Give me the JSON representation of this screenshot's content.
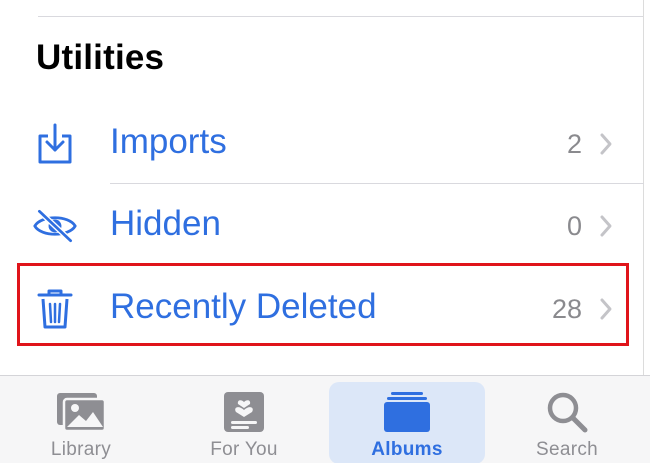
{
  "section": {
    "title": "Utilities"
  },
  "rows": [
    {
      "label": "Imports",
      "count": "2",
      "icon": "import-icon"
    },
    {
      "label": "Hidden",
      "count": "0",
      "icon": "eye-slash-icon"
    },
    {
      "label": "Recently Deleted",
      "count": "28",
      "icon": "trash-icon"
    }
  ],
  "tabs": [
    {
      "label": "Library",
      "icon": "photo-library-icon",
      "active": false
    },
    {
      "label": "For You",
      "icon": "for-you-icon",
      "active": false
    },
    {
      "label": "Albums",
      "icon": "albums-icon",
      "active": true
    },
    {
      "label": "Search",
      "icon": "search-icon",
      "active": false
    }
  ],
  "colors": {
    "accent": "#2f6fe0",
    "secondary_text": "#8a8a8e",
    "highlight": "#e0141a",
    "tab_inactive": "#8e8e93",
    "tab_active_bg": "#dce7f8"
  }
}
